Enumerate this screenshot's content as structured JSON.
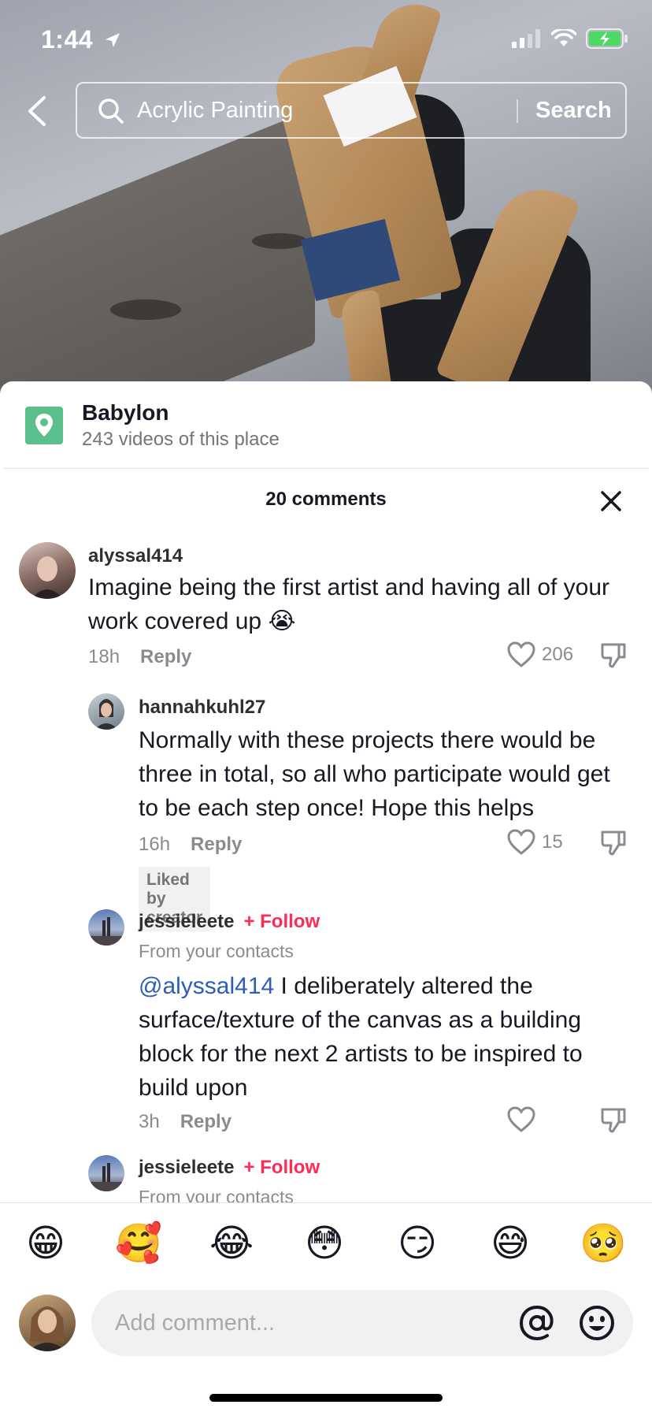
{
  "status_bar": {
    "time": "1:44"
  },
  "search": {
    "query": "Acrylic Painting",
    "button_label": "Search"
  },
  "place": {
    "name": "Babylon",
    "subtitle": "243 videos of this place"
  },
  "comments_header": {
    "count_label": "20 comments"
  },
  "comments": [
    {
      "username": "alyssal414",
      "text": "Imagine being the first artist and having all of your work covered up 😭",
      "time": "18h",
      "reply_label": "Reply",
      "likes": "206"
    },
    {
      "username": "hannahkuhl27",
      "text": "Normally with these projects there would be three in total, so all who participate would get to be each step once! Hope this helps",
      "time": "16h",
      "reply_label": "Reply",
      "likes": "15",
      "badge": "Liked by creator"
    },
    {
      "username": "jessieleete",
      "follow_label": "+ Follow",
      "contacts_label": "From your contacts",
      "mention": "@alyssal414",
      "text": " I deliberately altered the surface/texture of the canvas as a building block for the next 2 artists to be inspired to build upon",
      "time": "3h",
      "reply_label": "Reply",
      "likes": ""
    },
    {
      "username": "jessieleete",
      "follow_label": "+ Follow",
      "contacts_label": "From your contacts"
    }
  ],
  "emojis": [
    "😁",
    "🥰",
    "😂",
    "😳",
    "😏",
    "😅",
    "🥺"
  ],
  "composer": {
    "placeholder": "Add comment..."
  },
  "colors": {
    "follow": "#fe2c55",
    "mention": "#2b5db9",
    "place_icon": "#5bbf8c"
  }
}
